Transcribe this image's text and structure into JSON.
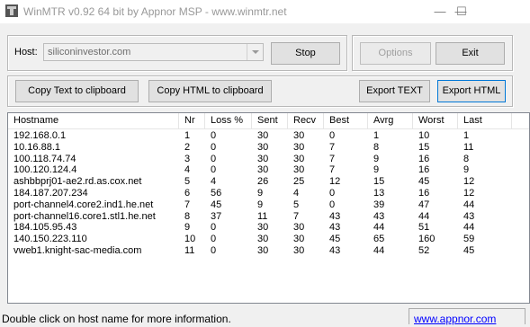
{
  "window": {
    "title": "WinMTR v0.92 64 bit by Appnor MSP - www.winmtr.net",
    "minimize_glyph": "—",
    "maximize_glyph": "☐",
    "icon": "app-icon"
  },
  "host": {
    "label": "Host:",
    "value": "siliconinvestor.com"
  },
  "buttons": {
    "stop": "Stop",
    "options": "Options",
    "exit": "Exit",
    "copy_text": "Copy Text to clipboard",
    "copy_html": "Copy HTML to clipboard",
    "export_text": "Export TEXT",
    "export_html": "Export HTML"
  },
  "table": {
    "columns": [
      "Hostname",
      "Nr",
      "Loss %",
      "Sent",
      "Recv",
      "Best",
      "Avrg",
      "Worst",
      "Last"
    ],
    "rows": [
      [
        "192.168.0.1",
        "1",
        "0",
        "30",
        "30",
        "0",
        "1",
        "10",
        "1"
      ],
      [
        "10.16.88.1",
        "2",
        "0",
        "30",
        "30",
        "7",
        "8",
        "15",
        "11"
      ],
      [
        "100.118.74.74",
        "3",
        "0",
        "30",
        "30",
        "7",
        "9",
        "16",
        "8"
      ],
      [
        "100.120.124.4",
        "4",
        "0",
        "30",
        "30",
        "7",
        "9",
        "16",
        "9"
      ],
      [
        "ashbbprj01-ae2.rd.as.cox.net",
        "5",
        "4",
        "26",
        "25",
        "12",
        "15",
        "45",
        "12"
      ],
      [
        "184.187.207.234",
        "6",
        "56",
        "9",
        "4",
        "0",
        "13",
        "16",
        "12"
      ],
      [
        "port-channel4.core2.ind1.he.net",
        "7",
        "45",
        "9",
        "5",
        "0",
        "39",
        "47",
        "44"
      ],
      [
        "port-channel16.core1.stl1.he.net",
        "8",
        "37",
        "11",
        "7",
        "43",
        "43",
        "44",
        "43"
      ],
      [
        "184.105.95.43",
        "9",
        "0",
        "30",
        "30",
        "43",
        "44",
        "51",
        "44"
      ],
      [
        "140.150.223.110",
        "10",
        "0",
        "30",
        "30",
        "45",
        "65",
        "160",
        "59"
      ],
      [
        "vweb1.knight-sac-media.com",
        "11",
        "0",
        "30",
        "30",
        "43",
        "44",
        "52",
        "45"
      ]
    ]
  },
  "status": {
    "message": "Double click on host name for more information.",
    "link": "www.appnor.com"
  },
  "colors": {
    "link": "#0000ff",
    "focus_border": "#0078d7",
    "disabled_text": "#a0a0a0"
  }
}
